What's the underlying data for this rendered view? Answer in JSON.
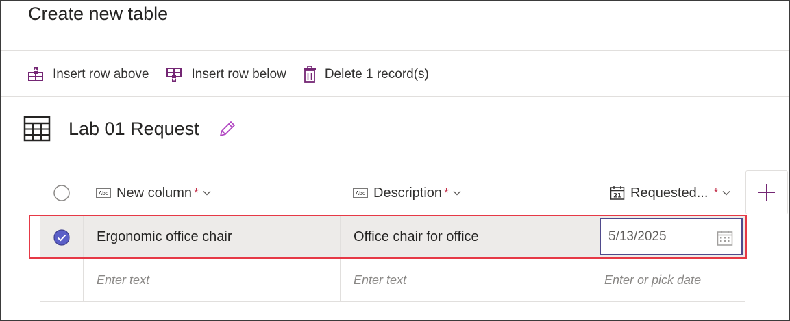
{
  "page": {
    "title": "Create new table"
  },
  "toolbar": {
    "insert_above": "Insert row above",
    "insert_below": "Insert row below",
    "delete": "Delete 1 record(s)"
  },
  "table": {
    "name": "Lab 01 Request"
  },
  "columns": [
    {
      "label": "New column",
      "required": "*",
      "type_icon": "text-type-icon"
    },
    {
      "label": "Description",
      "required": "*",
      "type_icon": "text-type-icon"
    },
    {
      "label": "Requested...",
      "required": "*",
      "type_icon": "date-type-icon"
    }
  ],
  "rows": [
    {
      "selected": true,
      "cells": [
        "Ergonomic office chair",
        "Office chair for office",
        "5/13/2025"
      ]
    }
  ],
  "new_row": {
    "placeholders": [
      "Enter text",
      "Enter text",
      "Enter or pick date"
    ]
  },
  "colors": {
    "accent": "#742774",
    "selected_check": "#5b5fc7",
    "highlight": "#e63946"
  }
}
